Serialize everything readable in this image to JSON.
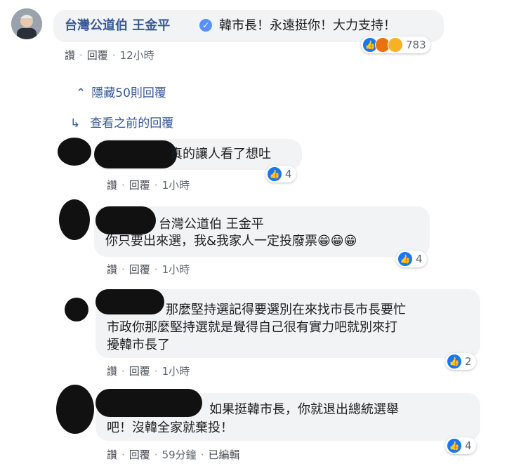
{
  "top_comment": {
    "author": "台灣公道伯 王金平",
    "text": "韓市長！永遠挺你！大力支持！",
    "like": "讚",
    "reply": "回覆",
    "time": "12小時",
    "reaction_count": "783"
  },
  "hide_replies": "隱藏50則回覆",
  "view_previous": "查看之前的回覆",
  "replies": [
    {
      "text": "真的讓人看了想吐",
      "like": "讚",
      "reply": "回覆",
      "time": "1小時",
      "reaction_count": "4"
    },
    {
      "mention": "台灣公道伯 王金平",
      "text": "你只要出來選，我&我家人一定投廢票😁😁😁",
      "like": "讚",
      "reply": "回覆",
      "time": "1小時",
      "reaction_count": "4"
    },
    {
      "line1": "那麼堅持選記得要選別在來找市長市長要忙",
      "line2": "市政你那麼堅持選就是覺得自己很有實力吧就別來打",
      "line3": "擾韓市長了",
      "like": "讚",
      "reply": "回覆",
      "time": "1小時",
      "reaction_count": "2"
    },
    {
      "line1": "如果挺韓市長，你就退出總統選舉",
      "line2": "吧！沒韓全家就棄投！",
      "like": "讚",
      "reply": "回覆",
      "time": "59分鐘",
      "edited": "已編輯",
      "reaction_count": "4"
    }
  ]
}
